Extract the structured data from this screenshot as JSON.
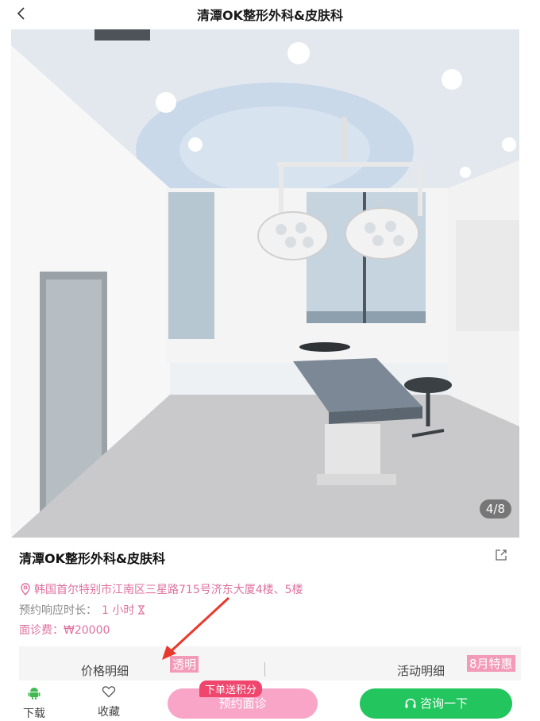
{
  "header": {
    "title": "清潭OK整形外科&皮肤科"
  },
  "gallery": {
    "counter": "4/8"
  },
  "clinic": {
    "name": "清潭OK整形外科&皮肤科",
    "address": "韩国首尔特别市江南区三星路715号济东大厦4楼、5楼",
    "response_label": "预约响应时长：",
    "response_value": "1 小时",
    "fee": "面诊费：₩20000"
  },
  "tabs": {
    "price": "价格明细",
    "activity": "活动明细"
  },
  "annotations": {
    "transparent": "透明",
    "august_special": "8月特惠"
  },
  "bottom_bar": {
    "download": "下载",
    "favorite": "收藏",
    "book_tag": "下单送积分",
    "book": "预约面诊",
    "consult": "咨询一下"
  },
  "colors": {
    "pink_text": "#e0719c",
    "book_button": "#f8a5c8",
    "consult_button": "#22c55e",
    "tag": "#f0466e",
    "arrow": "#e8392c"
  }
}
